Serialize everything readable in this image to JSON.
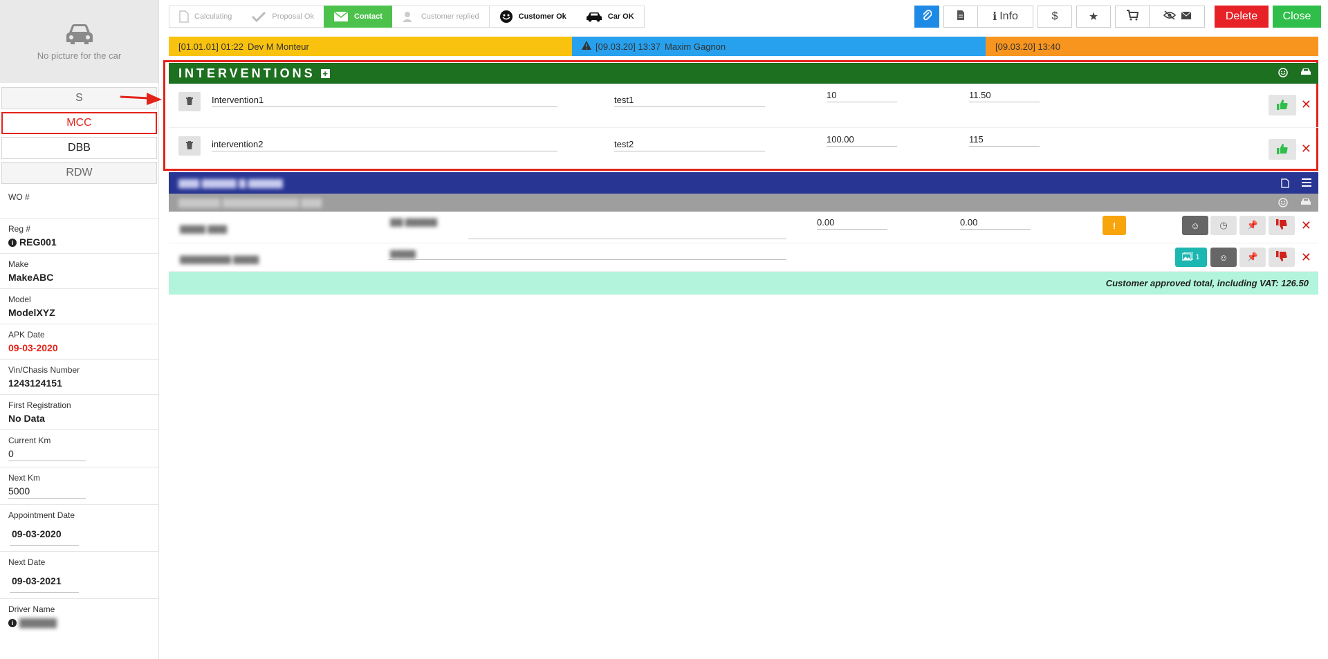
{
  "sidebar": {
    "photo_text": "No picture for the car",
    "tabs": [
      "S",
      "MCC",
      "DBB",
      "RDW"
    ],
    "fields": {
      "wo_label": "WO #",
      "reg_label": "Reg #",
      "reg_value": "REG001",
      "make_label": "Make",
      "make_value": "MakeABC",
      "model_label": "Model",
      "model_value": "ModelXYZ",
      "apk_label": "APK Date",
      "apk_value": "09-03-2020",
      "vin_label": "Vin/Chasis Number",
      "vin_value": "1243124151",
      "first_reg_label": "First Registration",
      "first_reg_value": "No Data",
      "current_km_label": "Current Km",
      "current_km_value": "0",
      "next_km_label": "Next Km",
      "next_km_value": "5000",
      "appointment_label": "Appointment Date",
      "appointment_value": "09-03-2020",
      "next_date_label": "Next Date",
      "next_date_value": "09-03-2021",
      "driver_label": "Driver Name"
    }
  },
  "steps": [
    {
      "label": "Calculating",
      "icon": "document-icon"
    },
    {
      "label": "Proposal Ok",
      "icon": "check-icon"
    },
    {
      "label": "Contact",
      "icon": "envelope-icon"
    },
    {
      "label": "Customer replied",
      "icon": "user-icon"
    },
    {
      "label": "Customer Ok",
      "icon": "smiley-icon"
    },
    {
      "label": "Car OK",
      "icon": "car-icon"
    }
  ],
  "toolbar": {
    "info_label": "Info",
    "dollar_label": "$",
    "delete_label": "Delete",
    "close_label": "Close"
  },
  "timeline": [
    {
      "time": "[01.01.01] 01:22",
      "name": "Dev M Monteur",
      "color": "#f9c20e"
    },
    {
      "time": "[09.03.20] 13:37",
      "name": "Maxim Gagnon",
      "color": "#27a1ee"
    },
    {
      "time": "[09.03.20] 13:40",
      "name": "",
      "color": "#f8951f"
    }
  ],
  "interventions": {
    "title": "INTERVENTIONS",
    "rows": [
      {
        "name": "Intervention1",
        "desc": "test1",
        "price": "10",
        "price_vat": "11.50"
      },
      {
        "name": "intervention2",
        "desc": "test2",
        "price": "100.00",
        "price_vat": "115"
      }
    ]
  },
  "section2": {
    "row1": {
      "value1": "0.00",
      "value2": "0.00"
    },
    "row2": {
      "photo_count": "1"
    },
    "total_label": "Customer approved total, including VAT: 126.50"
  },
  "colors": {
    "accent_green": "#1d701f",
    "section_blue": "#283593",
    "delete_red": "#e62227",
    "close_green": "#2fbe4a",
    "total_bg": "#b2f5dc"
  }
}
